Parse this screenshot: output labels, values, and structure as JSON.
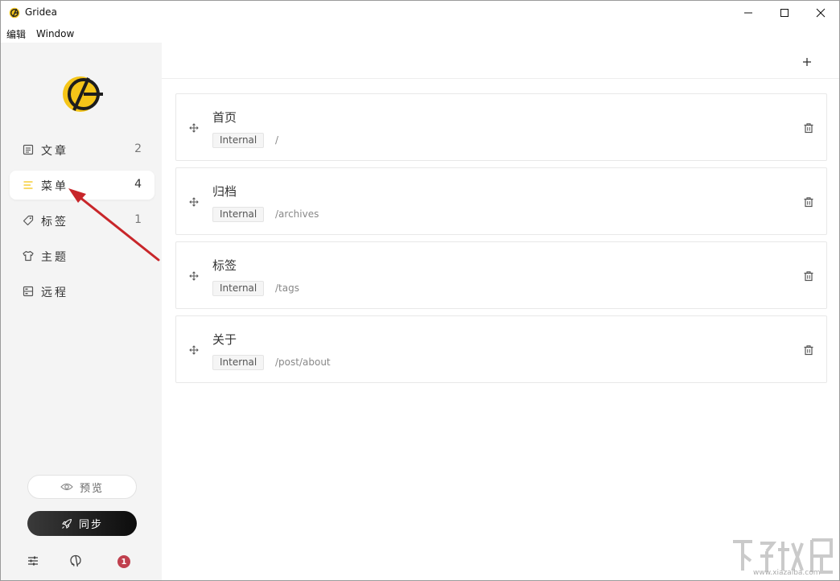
{
  "window": {
    "title": "Gridea"
  },
  "menubar": {
    "items": [
      "编辑",
      "Window"
    ]
  },
  "sidebar": {
    "nav": [
      {
        "label": "文章",
        "count": "2",
        "icon": "article-icon"
      },
      {
        "label": "菜单",
        "count": "4",
        "icon": "menu-icon",
        "active": true
      },
      {
        "label": "标签",
        "count": "1",
        "icon": "tag-icon"
      },
      {
        "label": "主题",
        "count": "",
        "icon": "shirt-icon"
      },
      {
        "label": "远程",
        "count": "",
        "icon": "server-icon"
      }
    ],
    "preview_label": "预览",
    "sync_label": "同步",
    "notification_count": "1"
  },
  "main": {
    "menus": [
      {
        "title": "首页",
        "type": "Internal",
        "link": "/"
      },
      {
        "title": "归档",
        "type": "Internal",
        "link": "/archives"
      },
      {
        "title": "标签",
        "type": "Internal",
        "link": "/tags"
      },
      {
        "title": "关于",
        "type": "Internal",
        "link": "/post/about"
      }
    ]
  },
  "watermark": {
    "text": "www.xiazaiba.com"
  },
  "colors": {
    "accent": "#f5c518",
    "sidebar_bg": "#f4f4f4",
    "badge": "#c0404e",
    "arrow": "#c8262a"
  }
}
